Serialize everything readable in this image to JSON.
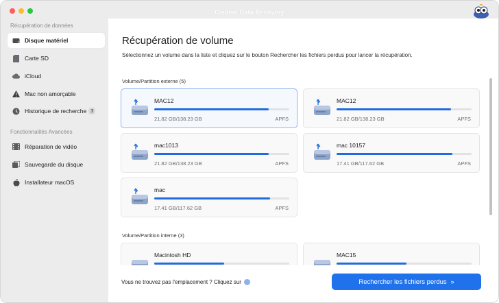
{
  "app": {
    "title": "Cisdem Data Recovery"
  },
  "sidebar": {
    "section1": "Récupération de données",
    "section2": "Fonctionnalités Avancées",
    "items": [
      {
        "label": "Disque matériel",
        "icon": "hard-drive-icon"
      },
      {
        "label": "Carte SD",
        "icon": "sd-card-icon"
      },
      {
        "label": "iCloud",
        "icon": "cloud-icon"
      },
      {
        "label": "Mac non amorçable",
        "icon": "warning-icon"
      },
      {
        "label": "Historique de recherche",
        "icon": "history-icon",
        "badge": "3"
      },
      {
        "label": "Réparation de vidéo",
        "icon": "film-icon"
      },
      {
        "label": "Sauvegarde du disque",
        "icon": "backup-icon"
      },
      {
        "label": "Installateur macOS",
        "icon": "apple-icon"
      }
    ]
  },
  "main": {
    "title": "Récupération de volume",
    "subtitle": "Sélectionnez un volume dans la liste et cliquez sur le bouton Rechercher les fichiers perdus pour lancer la récupération.",
    "external_label": "Volume/Partition externe (5)",
    "internal_label": "Volume/Partition interne (3)",
    "external": [
      {
        "name": "MAC12",
        "size": "21.82 GB/138.23 GB",
        "fs": "APFS",
        "fill": 0.85,
        "selected": true
      },
      {
        "name": "MAC12",
        "size": "21.82 GB/138.23 GB",
        "fs": "APFS",
        "fill": 0.85
      },
      {
        "name": "mac1013",
        "size": "21.82 GB/138.23 GB",
        "fs": "APFS",
        "fill": 0.85
      },
      {
        "name": "mac 10157",
        "size": "17.41 GB/117.62 GB",
        "fs": "APFS",
        "fill": 0.86
      },
      {
        "name": "mac",
        "size": "17.41 GB/117.62 GB",
        "fs": "APFS",
        "fill": 0.86
      }
    ],
    "internal": [
      {
        "name": "Macintosh HD",
        "fill": 0.52
      },
      {
        "name": "MAC15",
        "fill": 0.52
      }
    ],
    "hint": "Vous ne trouvez pas l'emplacement ? Cliquez sur",
    "scan_button": "Rechercher les fichiers perdus",
    "colors": {
      "accent": "#1f72ec",
      "bar": "#1f6bdf"
    }
  }
}
